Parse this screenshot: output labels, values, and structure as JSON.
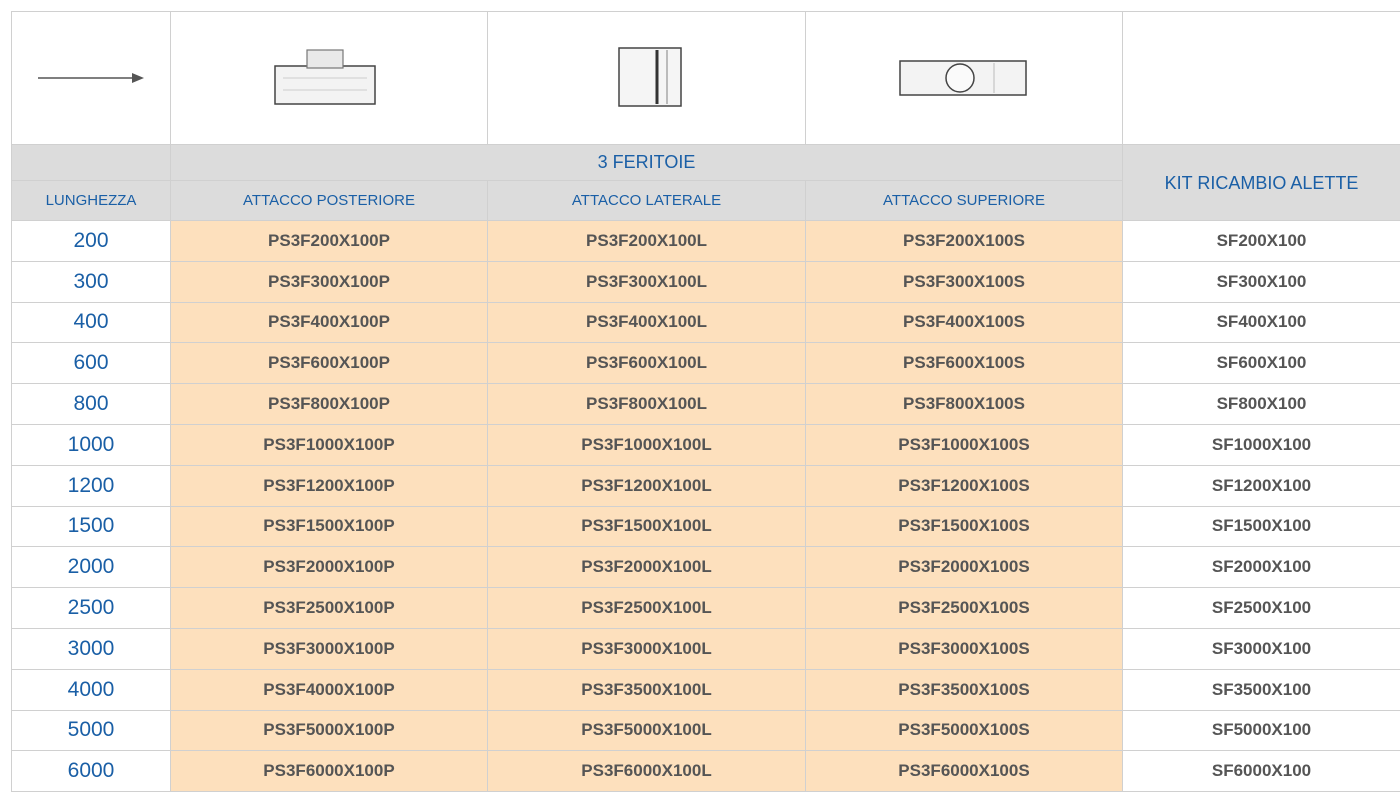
{
  "header": {
    "group_title": "3 FERITOIE",
    "kit_title": "KIT RICAMBIO ALETTE",
    "columns": [
      "LUNGHEZZA",
      "ATTACCO POSTERIORE",
      "ATTACCO LATERALE",
      "ATTACCO SUPERIORE"
    ]
  },
  "icons": [
    "arrow-right-icon",
    "rear-attachment-icon",
    "side-attachment-icon",
    "top-attachment-icon"
  ],
  "rows": [
    {
      "length": "200",
      "posteriore": "PS3F200X100P",
      "laterale": "PS3F200X100L",
      "superiore": "PS3F200X100S",
      "kit": "SF200X100"
    },
    {
      "length": "300",
      "posteriore": "PS3F300X100P",
      "laterale": "PS3F300X100L",
      "superiore": "PS3F300X100S",
      "kit": "SF300X100"
    },
    {
      "length": "400",
      "posteriore": "PS3F400X100P",
      "laterale": "PS3F400X100L",
      "superiore": "PS3F400X100S",
      "kit": "SF400X100"
    },
    {
      "length": "600",
      "posteriore": "PS3F600X100P",
      "laterale": "PS3F600X100L",
      "superiore": "PS3F600X100S",
      "kit": "SF600X100"
    },
    {
      "length": "800",
      "posteriore": "PS3F800X100P",
      "laterale": "PS3F800X100L",
      "superiore": "PS3F800X100S",
      "kit": "SF800X100"
    },
    {
      "length": "1000",
      "posteriore": "PS3F1000X100P",
      "laterale": "PS3F1000X100L",
      "superiore": "PS3F1000X100S",
      "kit": "SF1000X100"
    },
    {
      "length": "1200",
      "posteriore": "PS3F1200X100P",
      "laterale": "PS3F1200X100L",
      "superiore": "PS3F1200X100S",
      "kit": "SF1200X100"
    },
    {
      "length": "1500",
      "posteriore": "PS3F1500X100P",
      "laterale": "PS3F1500X100L",
      "superiore": "PS3F1500X100S",
      "kit": "SF1500X100"
    },
    {
      "length": "2000",
      "posteriore": "PS3F2000X100P",
      "laterale": "PS3F2000X100L",
      "superiore": "PS3F2000X100S",
      "kit": "SF2000X100"
    },
    {
      "length": "2500",
      "posteriore": "PS3F2500X100P",
      "laterale": "PS3F2500X100L",
      "superiore": "PS3F2500X100S",
      "kit": "SF2500X100"
    },
    {
      "length": "3000",
      "posteriore": "PS3F3000X100P",
      "laterale": "PS3F3000X100L",
      "superiore": "PS3F3000X100S",
      "kit": "SF3000X100"
    },
    {
      "length": "4000",
      "posteriore": "PS3F4000X100P",
      "laterale": "PS3F3500X100L",
      "superiore": "PS3F3500X100S",
      "kit": "SF3500X100"
    },
    {
      "length": "5000",
      "posteriore": "PS3F5000X100P",
      "laterale": "PS3F5000X100L",
      "superiore": "PS3F5000X100S",
      "kit": "SF5000X100"
    },
    {
      "length": "6000",
      "posteriore": "PS3F6000X100P",
      "laterale": "PS3F6000X100L",
      "superiore": "PS3F6000X100S",
      "kit": "SF6000X100"
    }
  ],
  "colors": {
    "code_fill": "#fde0bd",
    "header_fill": "#dcdcdc",
    "header_text": "#1a5fa6",
    "code_text": "#555555"
  }
}
